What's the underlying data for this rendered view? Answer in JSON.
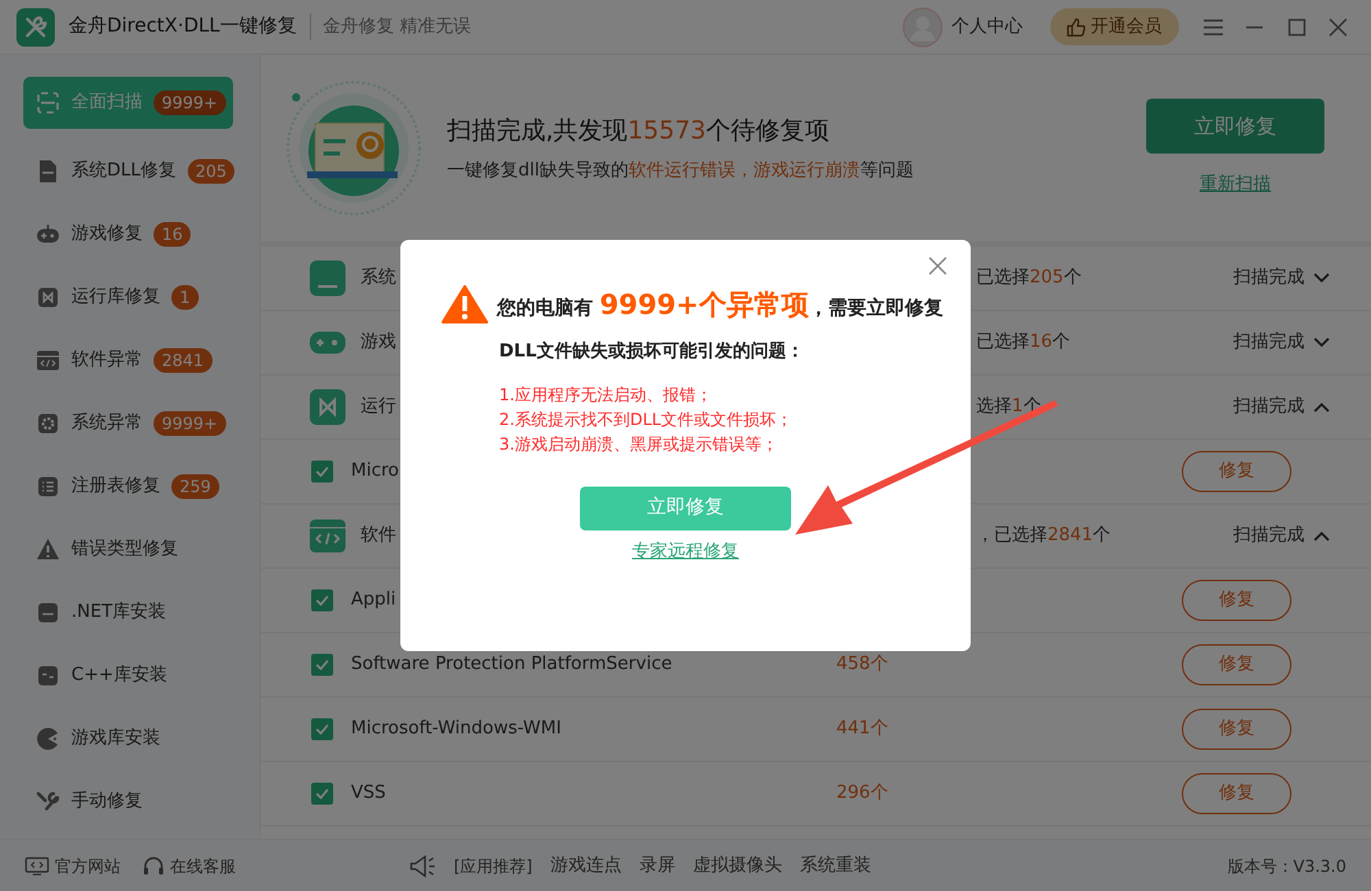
{
  "window": {
    "title": "金舟DirectX·DLL一键修复",
    "slogan": "金舟修复 精准无误",
    "user_label": "个人中心",
    "vip_button": "开通会员"
  },
  "sidebar": {
    "items": [
      {
        "label": "全面扫描",
        "badge": "9999+",
        "selected": true
      },
      {
        "label": "系统DLL修复",
        "badge": "205",
        "selected": false
      },
      {
        "label": "游戏修复",
        "badge": "16",
        "selected": false
      },
      {
        "label": "运行库修复",
        "badge": "1",
        "selected": false
      },
      {
        "label": "软件异常",
        "badge": "2841",
        "selected": false
      },
      {
        "label": "系统异常",
        "badge": "9999+",
        "selected": false
      },
      {
        "label": "注册表修复",
        "badge": "259",
        "selected": false
      },
      {
        "label": "错误类型修复",
        "selected": false
      },
      {
        "label": ".NET库安装",
        "selected": false
      },
      {
        "label": "C++库安装",
        "selected": false
      },
      {
        "label": "游戏库安装",
        "selected": false
      },
      {
        "label": "手动修复",
        "selected": false
      }
    ]
  },
  "scan_summary": {
    "headline": [
      {
        "text": "扫描完成,共发现",
        "highlight": false
      },
      {
        "text": "15573",
        "highlight": true
      },
      {
        "text": "个待修复项",
        "highlight": false
      }
    ],
    "subtitle": [
      {
        "text": "一键修复dll缺失导致的",
        "highlight": false
      },
      {
        "text": "软件运行错误，游戏运行崩溃",
        "highlight": true
      },
      {
        "text": "等问题",
        "highlight": false
      }
    ],
    "fix_button": "立即修复",
    "rescan_link": "重新扫描"
  },
  "list": {
    "rows": [
      {
        "kind": "category",
        "name": "系统",
        "selection": [
          {
            "text": "已选择",
            "highlight": false
          },
          {
            "text": "205",
            "highlight": true
          },
          {
            "text": "个",
            "highlight": false
          }
        ],
        "status": "扫描完成",
        "expanded": false
      },
      {
        "kind": "category",
        "name": "游戏",
        "selection": [
          {
            "text": "已选择",
            "highlight": false
          },
          {
            "text": "16",
            "highlight": true
          },
          {
            "text": "个",
            "highlight": false
          }
        ],
        "status": "扫描完成",
        "expanded": false
      },
      {
        "kind": "category",
        "name": "运行",
        "selection": [
          {
            "text": "选择",
            "highlight": false
          },
          {
            "text": "1",
            "highlight": true
          },
          {
            "text": "个",
            "highlight": false
          }
        ],
        "status": "扫描完成",
        "expanded": true
      },
      {
        "kind": "item",
        "name": "Micro",
        "checked": true,
        "button": "修复"
      },
      {
        "kind": "category",
        "name": "软件",
        "selection": [
          {
            "text": "，已选择",
            "highlight": false
          },
          {
            "text": "2841",
            "highlight": true
          },
          {
            "text": "个",
            "highlight": false
          }
        ],
        "status": "扫描完成",
        "expanded": true
      },
      {
        "kind": "item",
        "name": "Appli",
        "checked": true,
        "button": "修复"
      },
      {
        "kind": "item",
        "name": "Software Protection PlatformService",
        "count": "458个",
        "checked": true,
        "button": "修复"
      },
      {
        "kind": "item",
        "name": "Microsoft-Windows-WMI",
        "count": "441个",
        "checked": true,
        "button": "修复"
      },
      {
        "kind": "item",
        "name": "VSS",
        "count": "296个",
        "checked": true,
        "button": "修复"
      }
    ]
  },
  "status_bar": {
    "left_links": [
      "官方网站",
      "在线客服"
    ],
    "promo_label": "[应用推荐]",
    "promo_links": [
      "游戏连点",
      "录屏",
      "虚拟摄像头",
      "系统重装"
    ],
    "version": "版本号：V3.3.0"
  },
  "dialog": {
    "message": [
      {
        "text": "您的电脑有 ",
        "highlight": false
      },
      {
        "text": "9999+个异常项",
        "highlight": true
      },
      {
        "text": "，需要立即修复",
        "highlight": false
      }
    ],
    "subheading": "DLL文件缺失或损坏可能引发的问题：",
    "problems": [
      "1.应用程序无法启动、报错；",
      "2.系统提示找不到DLL文件或文件损坏；",
      "3.游戏启动崩溃、黑屏或提示错误等；"
    ],
    "primary_button": "立即修复",
    "secondary_link": "专家远程修复"
  }
}
